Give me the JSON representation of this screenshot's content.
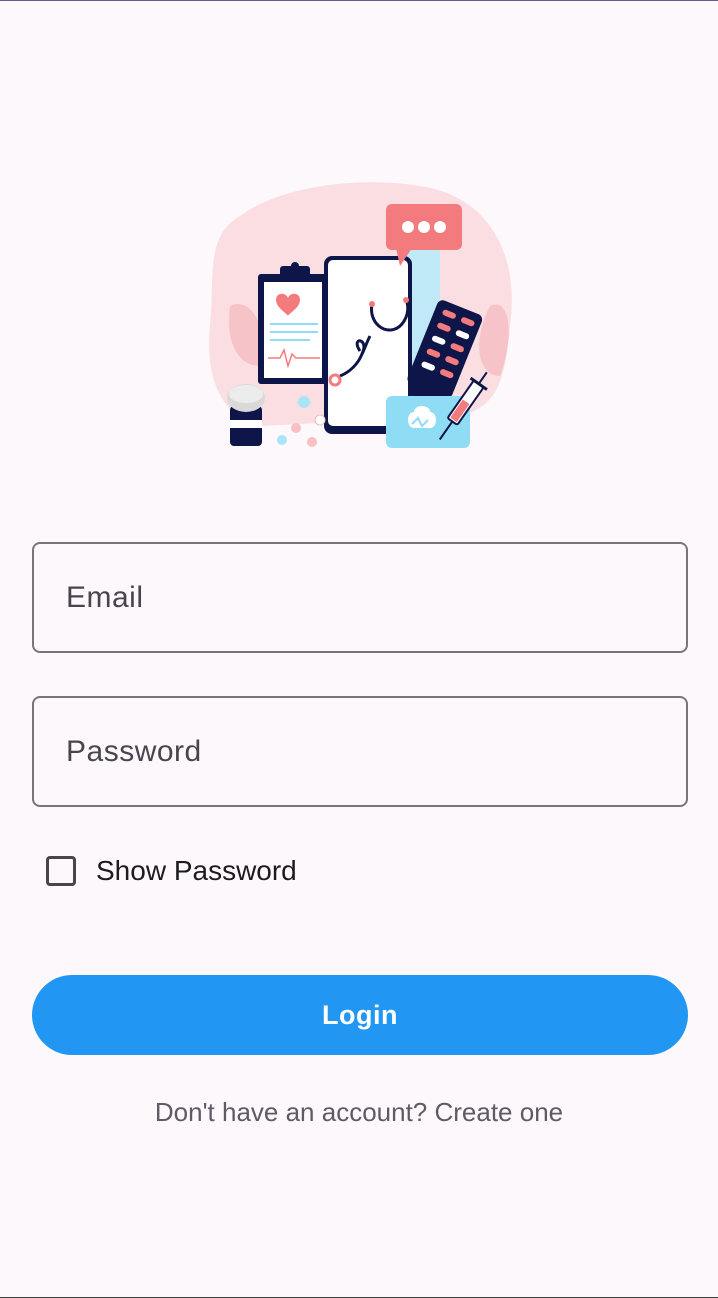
{
  "form": {
    "email_placeholder": "Email",
    "password_placeholder": "Password",
    "show_password_label": "Show Password",
    "login_label": "Login",
    "signup_text": "Don't have an account? Create one"
  },
  "colors": {
    "background": "#fdf8fc",
    "primary": "#2196f3",
    "outline": "#79747e",
    "illustration_pink": "#f9d5d9",
    "illustration_coral": "#f47b7d",
    "illustration_navy": "#0e1548",
    "illustration_cyan": "#8fdcf5"
  },
  "icons": {
    "hero": "medical-illustration",
    "chat": "chat-bubble-icon",
    "stethoscope": "stethoscope-icon",
    "clipboard": "clipboard-icon",
    "pills": "pill-pack-icon",
    "kit": "medical-kit-icon",
    "syringe": "syringe-icon",
    "jar": "pill-jar-icon"
  }
}
